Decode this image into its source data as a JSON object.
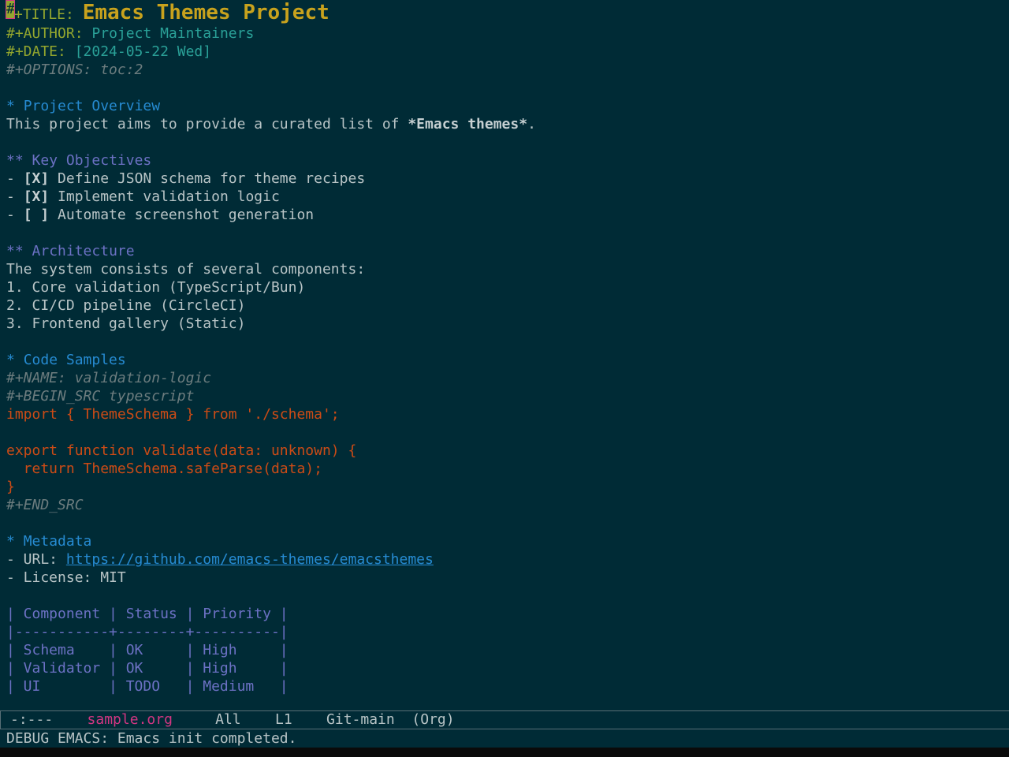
{
  "meta": {
    "title_key": "#+TITLE:",
    "title_value": "Emacs Themes Project",
    "author_key": "#+AUTHOR:",
    "author_value": "Project Maintainers",
    "date_key": "#+DATE:",
    "date_value": "[2024-05-22 Wed]",
    "options_line": "#+OPTIONS: toc:2"
  },
  "overview": {
    "heading_stars": "*",
    "heading": "Project Overview",
    "intro_text": "This project aims to provide a curated list of ",
    "intro_bold": "*Emacs themes*",
    "intro_end": "."
  },
  "objectives": {
    "heading_stars": "**",
    "heading": "Key Objectives",
    "items": [
      {
        "bullet": "- ",
        "box": "[X]",
        "text": " Define JSON schema for theme recipes"
      },
      {
        "bullet": "- ",
        "box": "[X]",
        "text": " Implement validation logic"
      },
      {
        "bullet": "- ",
        "box": "[ ]",
        "text": " Automate screenshot generation"
      }
    ]
  },
  "architecture": {
    "heading_stars": "**",
    "heading": "Architecture",
    "intro": "The system consists of several components:",
    "items": [
      "1. Core validation (TypeScript/Bun)",
      "2. CI/CD pipeline (CircleCI)",
      "3. Frontend gallery (Static)"
    ]
  },
  "code": {
    "heading_stars": "*",
    "heading": "Code Samples",
    "name_line": "#+NAME: validation-logic",
    "begin_line": "#+BEGIN_SRC typescript",
    "lines": [
      "import { ThemeSchema } from './schema';",
      "",
      "export function validate(data: unknown) {",
      "  return ThemeSchema.safeParse(data);",
      "}"
    ],
    "end_line": "#+END_SRC"
  },
  "metadata": {
    "heading_stars": "*",
    "heading": "Metadata",
    "url_prefix": "- URL: ",
    "url": "https://github.com/emacs-themes/emacsthemes",
    "license": "- License: MIT"
  },
  "table": {
    "rows": [
      "| Component | Status | Priority |",
      "|-----------+--------+----------|",
      "| Schema    | OK     | High     |",
      "| Validator | OK     | High     |",
      "| UI        | TODO   | Medium   |"
    ]
  },
  "modeline": {
    "status": "-:---",
    "buffer": "sample.org",
    "position": "All",
    "line": "L1",
    "vc": "Git-main",
    "mode": "(Org)"
  },
  "echo": "DEBUG EMACS: Emacs init completed."
}
